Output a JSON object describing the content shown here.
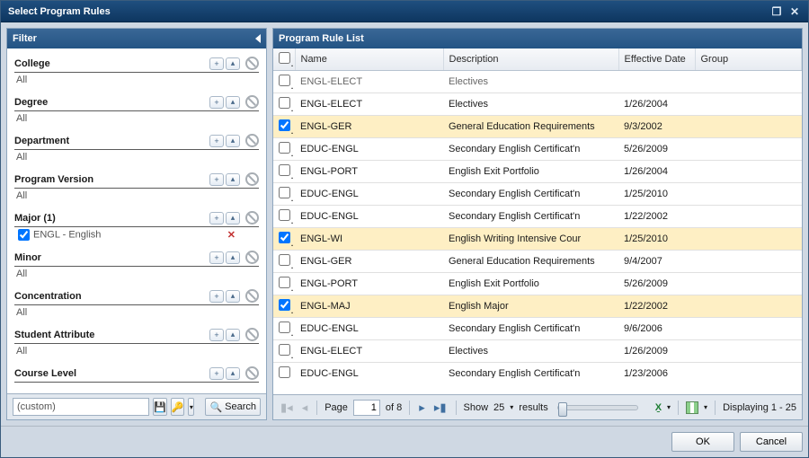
{
  "window": {
    "title": "Select Program Rules"
  },
  "filter_panel": {
    "title": "Filter",
    "custom_label": "(custom)",
    "search_label": "Search",
    "groups": [
      {
        "label": "College",
        "value": "All"
      },
      {
        "label": "Degree",
        "value": "All"
      },
      {
        "label": "Department",
        "value": "All"
      },
      {
        "label": "Program Version",
        "value": "All"
      },
      {
        "label": "Major (1)",
        "value": "ENGL - English",
        "checked": true,
        "removable": true
      },
      {
        "label": "Minor",
        "value": "All"
      },
      {
        "label": "Concentration",
        "value": "All"
      },
      {
        "label": "Student Attribute",
        "value": "All"
      },
      {
        "label": "Course Level",
        "value": ""
      }
    ]
  },
  "list_panel": {
    "title": "Program Rule List",
    "columns": {
      "name": "Name",
      "description": "Description",
      "effective_date": "Effective Date",
      "group": "Group"
    },
    "rows": [
      {
        "checked": false,
        "name": "ENGL-ELECT",
        "description": "Electives",
        "date": "",
        "group": "",
        "partial": true
      },
      {
        "checked": false,
        "name": "ENGL-ELECT",
        "description": "Electives",
        "date": "1/26/2004",
        "group": ""
      },
      {
        "checked": true,
        "name": "ENGL-GER",
        "description": "General Education Requirements",
        "date": "9/3/2002",
        "group": ""
      },
      {
        "checked": false,
        "name": "EDUC-ENGL",
        "description": "Secondary English Certificat'n",
        "date": "5/26/2009",
        "group": ""
      },
      {
        "checked": false,
        "name": "ENGL-PORT",
        "description": "English Exit Portfolio",
        "date": "1/26/2004",
        "group": ""
      },
      {
        "checked": false,
        "name": "EDUC-ENGL",
        "description": "Secondary English Certificat'n",
        "date": "1/25/2010",
        "group": ""
      },
      {
        "checked": false,
        "name": "EDUC-ENGL",
        "description": "Secondary English Certificat'n",
        "date": "1/22/2002",
        "group": ""
      },
      {
        "checked": true,
        "name": "ENGL-WI",
        "description": "English Writing Intensive Cour",
        "date": "1/25/2010",
        "group": ""
      },
      {
        "checked": false,
        "name": "ENGL-GER",
        "description": "General Education Requirements",
        "date": "9/4/2007",
        "group": ""
      },
      {
        "checked": false,
        "name": "ENGL-PORT",
        "description": "English Exit Portfolio",
        "date": "5/26/2009",
        "group": ""
      },
      {
        "checked": true,
        "name": "ENGL-MAJ",
        "description": "English Major",
        "date": "1/22/2002",
        "group": ""
      },
      {
        "checked": false,
        "name": "EDUC-ENGL",
        "description": "Secondary English Certificat'n",
        "date": "9/6/2006",
        "group": ""
      },
      {
        "checked": false,
        "name": "ENGL-ELECT",
        "description": "Electives",
        "date": "1/26/2009",
        "group": ""
      },
      {
        "checked": false,
        "name": "EDUC-ENGL",
        "description": "Secondary English Certificat'n",
        "date": "1/23/2006",
        "group": ""
      }
    ],
    "pager": {
      "page_label_prefix": "Page",
      "page": "1",
      "pages_suffix": "of 8",
      "show_label": "Show",
      "page_size": "25",
      "results_label": "results",
      "displaying": "Displaying 1 - 25"
    }
  },
  "footer": {
    "ok": "OK",
    "cancel": "Cancel"
  }
}
